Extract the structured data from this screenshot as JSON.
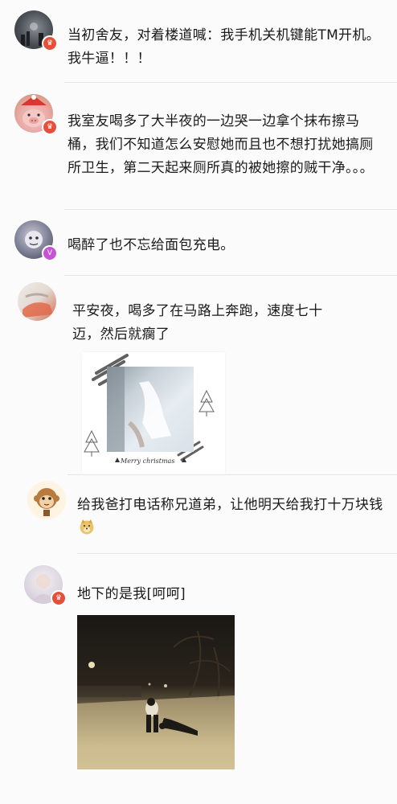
{
  "comments": [
    {
      "text": "当初舍友，对着楼道喊：我手机关机键能TM开机。我牛逼！！！",
      "badge": "vip-crown-icon",
      "badge_color": "#e4503a"
    },
    {
      "text": "我室友喝多了大半夜的一边哭一边拿个抹布擦马桶，我们不知道怎么安慰她而且也不想打扰她搞厕所卫生，第二天起来厕所真的被她擦的贼干净。。。",
      "badge": "vip-crown-icon",
      "badge_color": "#e4503a"
    },
    {
      "text": "喝醉了也不忘给面包充电。",
      "badge": "v-verified-icon",
      "badge_color": "#c652d6"
    },
    {
      "text": "平安夜，喝多了在马路上奔跑，速度七十迈，然后就瘸了",
      "card_caption": "Merry christmas"
    },
    {
      "text": "给我爸打电话称兄道弟，让他明天给我打十万块钱",
      "emoji": "doge-emoji"
    },
    {
      "text": "地下的是我[呵呵]",
      "badge": "vip-crown-icon",
      "badge_color": "#e4503a"
    }
  ]
}
